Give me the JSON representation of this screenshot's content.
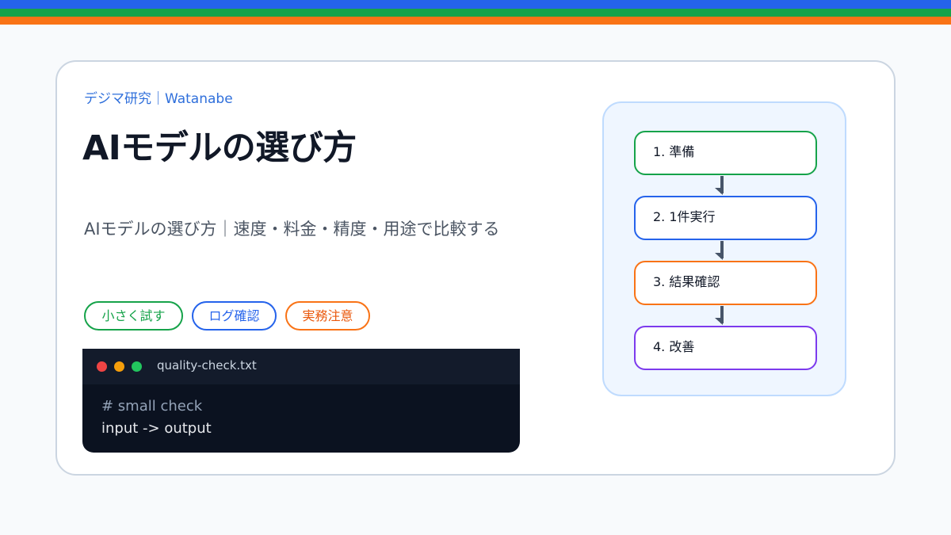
{
  "header": {
    "brand": "デジマ研究｜Watanabe",
    "title": "AIモデルの選び方",
    "subtitle": "AIモデルの選び方｜速度・料金・精度・用途で比較する"
  },
  "tags": [
    "小さく試す",
    "ログ確認",
    "実務注意"
  ],
  "terminal": {
    "filename": "quality-check.txt",
    "comment": "# small check",
    "code": "input -> output"
  },
  "flow": {
    "steps": [
      "1. 準備",
      "2. 1件実行",
      "3. 結果確認",
      "4. 改善"
    ]
  },
  "colors": {
    "stripe_blue": "#2563eb",
    "stripe_green": "#16a34a",
    "stripe_orange": "#f97316",
    "step_purple": "#7c3aed"
  }
}
